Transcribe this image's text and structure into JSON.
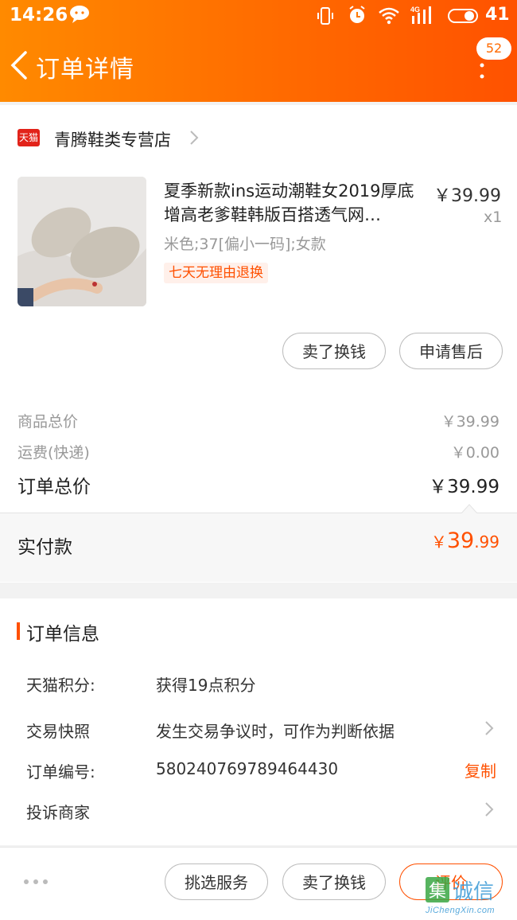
{
  "status_bar": {
    "time": "14:26",
    "battery_level": "41",
    "network": "4G"
  },
  "header": {
    "title": "订单详情",
    "badge_count": "52"
  },
  "shop": {
    "name": "青腾鞋类专营店",
    "badge": "天猫"
  },
  "product": {
    "title": "夏季新款ins运动潮鞋女2019厚底增高老爹鞋韩版百搭透气网…",
    "price": "￥39.99",
    "quantity": "x1",
    "sku": "米色;37[偏小一码];女款",
    "tag": "七天无理由退换"
  },
  "item_actions": {
    "sell_label": "卖了换钱",
    "after_sale_label": "申请售后"
  },
  "summary": {
    "goods_label": "商品总价",
    "goods_value": "￥39.99",
    "shipping_label": "运费(快递)",
    "shipping_value": "￥0.00",
    "total_label": "订单总价",
    "total_value": "￥39.99",
    "paid_label": "实付款",
    "paid_currency": "￥",
    "paid_int": "39",
    "paid_dec": ".99"
  },
  "order_info": {
    "title": "订单信息",
    "rows": [
      {
        "label": "天猫积分:",
        "value": "获得19点积分"
      },
      {
        "label": "交易快照",
        "value": "发生交易争议时，可作为判断依据"
      },
      {
        "label": "订单编号:",
        "value": "580240769789464430",
        "action": "复制"
      },
      {
        "label": "投诉商家",
        "value": ""
      }
    ]
  },
  "bottom_bar": {
    "pick_service_label": "挑选服务",
    "sell_label": "卖了换钱",
    "rate_label": "评价"
  },
  "watermark": {
    "main": "集诚信",
    "sub": "JiChengXin.com"
  },
  "colors": {
    "accent": "#ff5000",
    "header_start": "#ff8a00",
    "header_end": "#ff5200"
  }
}
